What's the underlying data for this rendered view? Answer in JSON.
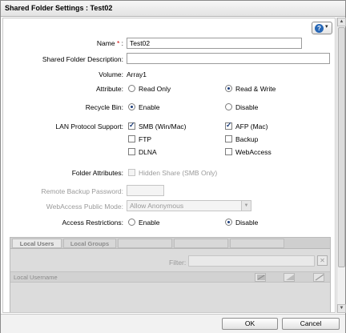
{
  "dialog": {
    "title": "Shared Folder Settings : Test02"
  },
  "help": {
    "icon": "question-icon",
    "menu_icon": "chevron-down-icon"
  },
  "form": {
    "name": {
      "label": "Name",
      "required_mark": "*",
      "colon": ":",
      "value": "Test02"
    },
    "description": {
      "label": "Shared Folder Description:",
      "value": ""
    },
    "volume": {
      "label": "Volume:",
      "value": "Array1"
    },
    "attribute": {
      "label": "Attribute:",
      "options": [
        "Read Only",
        "Read & Write"
      ],
      "selected": "Read & Write"
    },
    "recycle_bin": {
      "label": "Recycle Bin:",
      "options": [
        "Enable",
        "Disable"
      ],
      "selected": "Enable"
    },
    "lan_protocol": {
      "label": "LAN Protocol Support:",
      "options": [
        {
          "label": "SMB (Win/Mac)",
          "checked": true
        },
        {
          "label": "AFP (Mac)",
          "checked": true
        },
        {
          "label": "FTP",
          "checked": false
        },
        {
          "label": "Backup",
          "checked": false
        },
        {
          "label": "DLNA",
          "checked": false
        },
        {
          "label": "WebAccess",
          "checked": false
        }
      ]
    },
    "folder_attributes": {
      "label": "Folder Attributes:",
      "option": "Hidden Share (SMB Only)",
      "checked": false,
      "disabled": true
    },
    "remote_backup_password": {
      "label": "Remote Backup Password:",
      "value": "",
      "disabled": true
    },
    "webaccess_public_mode": {
      "label": "WebAccess Public Mode:",
      "value": "Allow Anonymous",
      "disabled": true
    },
    "access_restrictions": {
      "label": "Access Restrictions:",
      "options": [
        "Enable",
        "Disable"
      ],
      "selected": "Disable"
    }
  },
  "access_panel": {
    "tabs": [
      "Local Users",
      "Local Groups",
      "",
      "",
      ""
    ],
    "filter_label": "Filter:",
    "filter_value": "",
    "clear_icon": "close-icon",
    "column_header": "Local Username",
    "column_icons": [
      "read-write-icon",
      "read-only-icon",
      "no-access-icon"
    ]
  },
  "buttons": {
    "ok": "OK",
    "cancel": "Cancel"
  },
  "colors": {
    "accent": "#2767b6",
    "disabled_text": "#9a9a9a",
    "required": "#d00000"
  }
}
